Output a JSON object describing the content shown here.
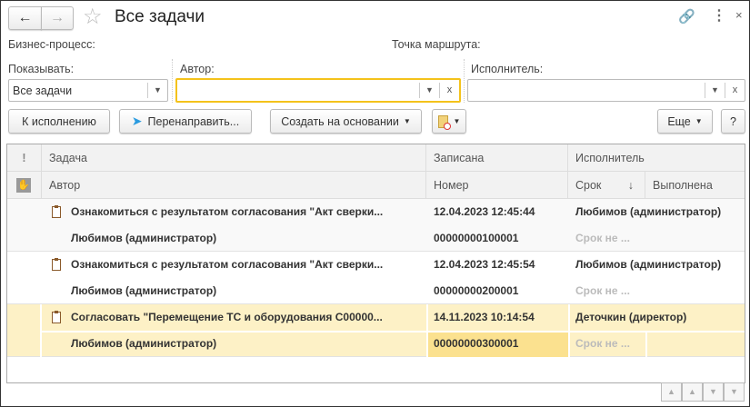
{
  "header": {
    "title": "Все задачи",
    "back_icon": "arrow-left",
    "forward_icon": "arrow-right",
    "star_icon": "star",
    "link_icon": "link",
    "more_icon": "vertical-dots",
    "close_icon": "x"
  },
  "filters": {
    "business_process_label": "Бизнес-процесс:",
    "route_point_label": "Точка маршрута:",
    "show_label": "Показывать:",
    "show_value": "Все задачи",
    "author_label": "Автор:",
    "author_value": "",
    "executor_label": "Исполнитель:",
    "executor_value": "",
    "clear_glyph": "x"
  },
  "toolbar": {
    "execute": "К исполнению",
    "redirect": "Перенаправить...",
    "create_based": "Создать на основании",
    "more": "Еще",
    "help": "?"
  },
  "table": {
    "headers": {
      "task": "Задача",
      "recorded": "Записана",
      "executor": "Исполнитель",
      "author": "Автор",
      "number": "Номер",
      "deadline": "Срок",
      "completed": "Выполнена",
      "sort_glyph": "↓",
      "importance_glyph": "!"
    },
    "rows": [
      {
        "task": "Ознакомиться с результатом согласования \"Акт сверки...",
        "recorded": "12.04.2023 12:45:44",
        "executor": "Любимов (администратор)",
        "author": "Любимов (администратор)",
        "number": "00000000100001",
        "deadline": "Срок не ..."
      },
      {
        "task": "Ознакомиться с результатом согласования \"Акт сверки...",
        "recorded": "12.04.2023 12:45:54",
        "executor": "Любимов (администратор)",
        "author": "Любимов (администратор)",
        "number": "00000000200001",
        "deadline": "Срок не ..."
      },
      {
        "task": "Согласовать \"Перемещение ТС и оборудования С00000...",
        "recorded": "14.11.2023 10:14:54",
        "executor": "Деточкин (директор)",
        "author": "Любимов (администратор)",
        "number": "00000000300001",
        "deadline": "Срок не ..."
      }
    ]
  },
  "colors": {
    "selected_row": "#fdf1c6",
    "selected_cell": "#fbe18f",
    "focus_border": "#f4c21b"
  }
}
